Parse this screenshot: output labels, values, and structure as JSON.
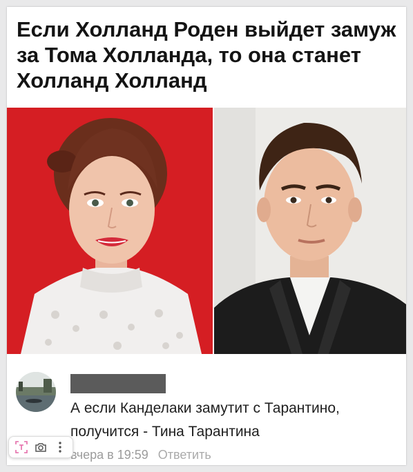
{
  "post": {
    "headline": "Если Холланд Роден выйдет замуж за Тома Холланда, то она станет Холланд Холланд"
  },
  "images": {
    "left": "woman-portrait",
    "right": "man-portrait"
  },
  "comment": {
    "text": "А если Канделаки замутит с Тарантино, получится - Тина Тарантина",
    "time": "вчера в 19:59",
    "reply_label": "Ответить"
  },
  "colors": {
    "left_bg": "#d51e23",
    "right_bg": "#ecebe8",
    "redaction": "#5b5b5b"
  },
  "toolbar": {
    "icons": [
      "scan-icon",
      "camera-icon",
      "more-vertical-icon"
    ]
  }
}
